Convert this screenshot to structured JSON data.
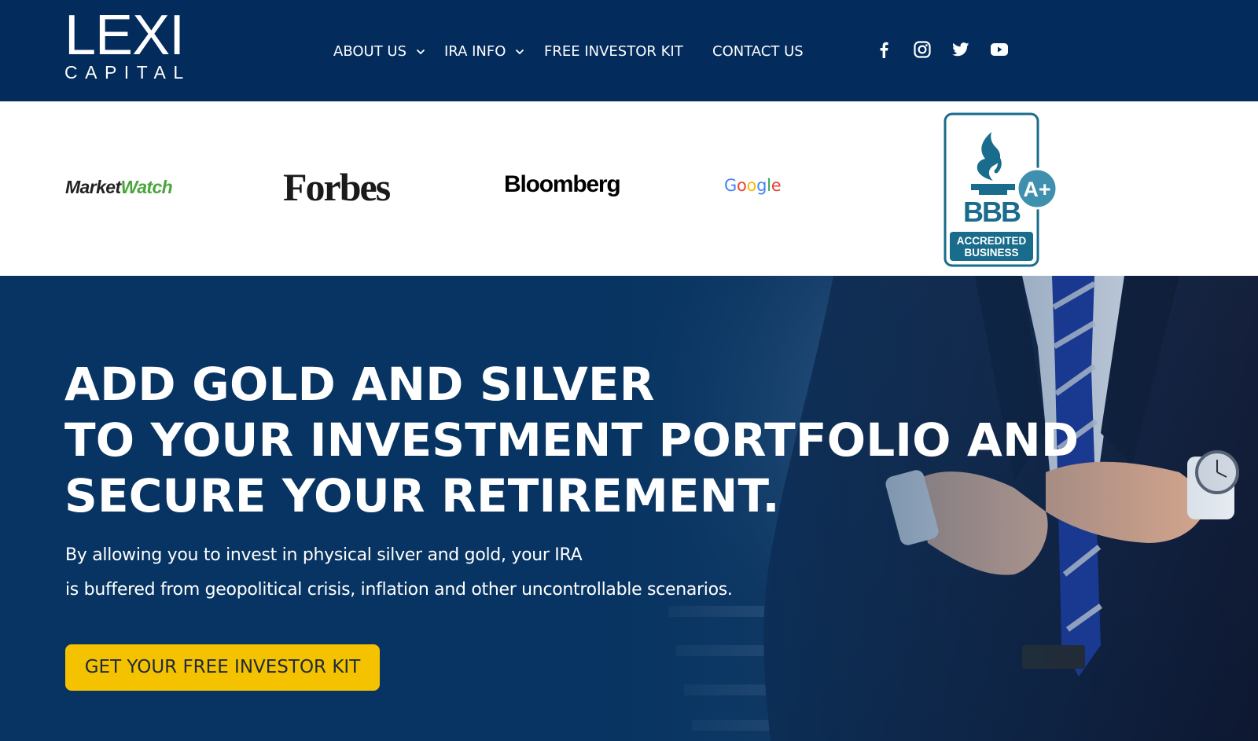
{
  "header": {
    "logo": {
      "main": "LEXI",
      "sub": "CAPITAL"
    },
    "nav": [
      {
        "label": "ABOUT US",
        "has_dropdown": true
      },
      {
        "label": "IRA INFO",
        "has_dropdown": true
      },
      {
        "label": "FREE INVESTOR KIT",
        "has_dropdown": false
      },
      {
        "label": "CONTACT US",
        "has_dropdown": false
      }
    ],
    "social": [
      "facebook-icon",
      "instagram-icon",
      "twitter-icon",
      "youtube-icon"
    ]
  },
  "press": {
    "marketwatch": {
      "part1": "Market",
      "part2": "Watch"
    },
    "forbes": "Forbes",
    "bloomberg": "Bloomberg",
    "google": [
      "G",
      "o",
      "o",
      "g",
      "l",
      "e"
    ],
    "bbb": {
      "grade": "A+",
      "mark": "BBB",
      "line1": "ACCREDITED",
      "line2": "BUSINESS"
    }
  },
  "hero": {
    "title_lines": [
      "ADD GOLD AND SILVER",
      "TO YOUR INVESTMENT PORTFOLIO AND",
      "SECURE YOUR RETIREMENT."
    ],
    "text_lines": [
      "By allowing you to invest in physical silver and gold, your IRA",
      "is buffered from geopolitical crisis, inflation and other uncontrollable scenarios."
    ],
    "cta_label": "GET YOUR FREE INVESTOR KIT"
  },
  "colors": {
    "navy": "#032b5c",
    "cta_yellow": "#f5c200",
    "marketwatch_green": "#4aa53c",
    "google": [
      "#4285f4",
      "#ea4335",
      "#fbbc05",
      "#4285f4",
      "#34a853",
      "#ea4335"
    ],
    "bbb_blue": "#1a6c8c"
  }
}
